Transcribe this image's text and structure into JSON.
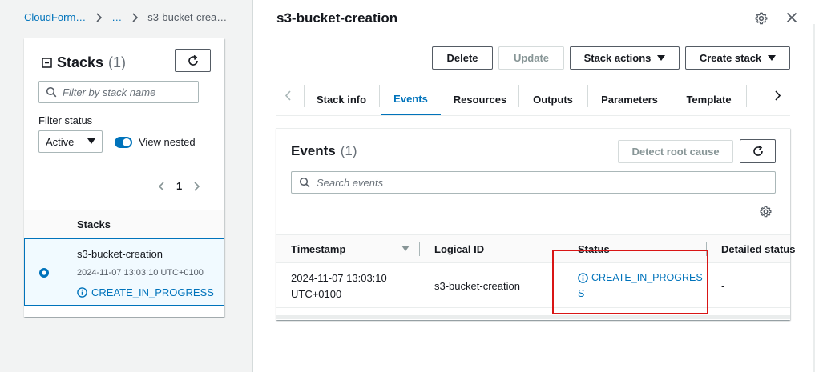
{
  "breadcrumb": {
    "root": "CloudForm…",
    "middle": "…",
    "current": "s3-bucket-crea…"
  },
  "stacks_panel": {
    "title": "Stacks",
    "count": "(1)",
    "filter_placeholder": "Filter by stack name",
    "filter_status_label": "Filter status",
    "filter_status_value": "Active",
    "view_nested_label": "View nested",
    "view_nested_on": true,
    "page_number": "1",
    "column_header": "Stacks",
    "rows": [
      {
        "name": "s3-bucket-creation",
        "timestamp": "2024-11-07 13:03:10 UTC+0100",
        "status": "CREATE_IN_PROGRESS",
        "selected": true
      }
    ]
  },
  "detail": {
    "title": "s3-bucket-creation",
    "actions": {
      "delete": "Delete",
      "update": "Update",
      "stack_actions": "Stack actions",
      "create_stack": "Create stack"
    },
    "tabs": [
      {
        "label": "Stack info",
        "active": false
      },
      {
        "label": "Events",
        "active": true
      },
      {
        "label": "Resources",
        "active": false
      },
      {
        "label": "Outputs",
        "active": false
      },
      {
        "label": "Parameters",
        "active": false
      },
      {
        "label": "Template",
        "active": false
      }
    ],
    "events": {
      "title": "Events",
      "count": "(1)",
      "detect_root_cause": "Detect root cause",
      "search_placeholder": "Search events",
      "columns": {
        "timestamp": "Timestamp",
        "logical_id": "Logical ID",
        "status": "Status",
        "detailed_status": "Detailed status"
      },
      "rows": [
        {
          "timestamp_line1": "2024-11-07 13:03:10",
          "timestamp_line2": "UTC+0100",
          "logical_id": "s3-bucket-creation",
          "status_line1": "CREATE_IN_PROGRES",
          "status_line2": "S",
          "detailed_status": "-"
        }
      ]
    }
  },
  "colors": {
    "link": "#0073bb",
    "highlight_box": "#d91515",
    "selected_row_bg": "#f1faff",
    "selected_border": "#0073bb"
  }
}
